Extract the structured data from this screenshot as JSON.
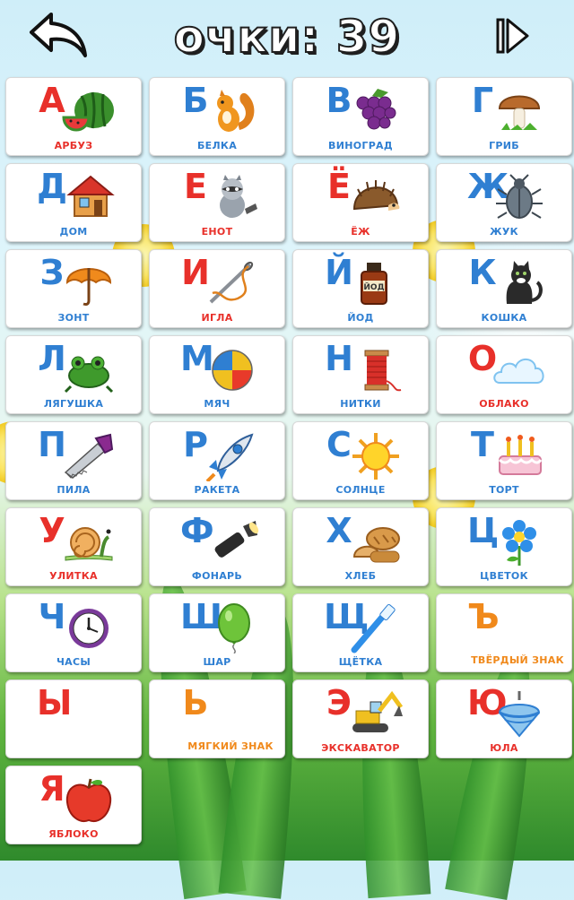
{
  "header": {
    "score_text": "очки: 39",
    "back_icon": "back-arrow-icon",
    "skip_icon": "skip-forward-icon"
  },
  "colors": {
    "vowel": "#e8302a",
    "consonant": "#2f7fd2",
    "sign": "#f0891b"
  },
  "cards": [
    {
      "letter": "А",
      "word": "АРБУЗ",
      "letter_color": "red",
      "word_color": "red",
      "icon": "watermelon"
    },
    {
      "letter": "Б",
      "word": "БЕЛКА",
      "letter_color": "blue",
      "word_color": "blue",
      "icon": "squirrel"
    },
    {
      "letter": "В",
      "word": "ВИНОГРАД",
      "letter_color": "blue",
      "word_color": "blue",
      "icon": "grapes"
    },
    {
      "letter": "Г",
      "word": "ГРИБ",
      "letter_color": "blue",
      "word_color": "blue",
      "icon": "mushroom"
    },
    {
      "letter": "Д",
      "word": "ДОМ",
      "letter_color": "blue",
      "word_color": "blue",
      "icon": "house"
    },
    {
      "letter": "Е",
      "word": "ЕНОТ",
      "letter_color": "red",
      "word_color": "red",
      "icon": "raccoon"
    },
    {
      "letter": "Ё",
      "word": "ЁЖ",
      "letter_color": "red",
      "word_color": "red",
      "icon": "hedgehog"
    },
    {
      "letter": "Ж",
      "word": "ЖУК",
      "letter_color": "blue",
      "word_color": "blue",
      "icon": "beetle"
    },
    {
      "letter": "З",
      "word": "ЗОНТ",
      "letter_color": "blue",
      "word_color": "blue",
      "icon": "umbrella"
    },
    {
      "letter": "И",
      "word": "ИГЛА",
      "letter_color": "red",
      "word_color": "red",
      "icon": "needle"
    },
    {
      "letter": "Й",
      "word": "ЙОД",
      "letter_color": "blue",
      "word_color": "blue",
      "icon": "iodine-bottle"
    },
    {
      "letter": "К",
      "word": "КОШКА",
      "letter_color": "blue",
      "word_color": "blue",
      "icon": "cat"
    },
    {
      "letter": "Л",
      "word": "ЛЯГУШКА",
      "letter_color": "blue",
      "word_color": "blue",
      "icon": "frog"
    },
    {
      "letter": "М",
      "word": "МЯЧ",
      "letter_color": "blue",
      "word_color": "blue",
      "icon": "ball"
    },
    {
      "letter": "Н",
      "word": "НИТКИ",
      "letter_color": "blue",
      "word_color": "blue",
      "icon": "thread-spool"
    },
    {
      "letter": "О",
      "word": "ОБЛАКО",
      "letter_color": "red",
      "word_color": "red",
      "icon": "cloud"
    },
    {
      "letter": "П",
      "word": "ПИЛА",
      "letter_color": "blue",
      "word_color": "blue",
      "icon": "saw"
    },
    {
      "letter": "Р",
      "word": "РАКЕТА",
      "letter_color": "blue",
      "word_color": "blue",
      "icon": "rocket"
    },
    {
      "letter": "С",
      "word": "СОЛНЦЕ",
      "letter_color": "blue",
      "word_color": "blue",
      "icon": "sun"
    },
    {
      "letter": "Т",
      "word": "ТОРТ",
      "letter_color": "blue",
      "word_color": "blue",
      "icon": "cake"
    },
    {
      "letter": "У",
      "word": "УЛИТКА",
      "letter_color": "red",
      "word_color": "red",
      "icon": "snail"
    },
    {
      "letter": "Ф",
      "word": "ФОНАРЬ",
      "letter_color": "blue",
      "word_color": "blue",
      "icon": "flashlight"
    },
    {
      "letter": "Х",
      "word": "ХЛЕБ",
      "letter_color": "blue",
      "word_color": "blue",
      "icon": "bread"
    },
    {
      "letter": "Ц",
      "word": "ЦВЕТОК",
      "letter_color": "blue",
      "word_color": "blue",
      "icon": "flower"
    },
    {
      "letter": "Ч",
      "word": "ЧАСЫ",
      "letter_color": "blue",
      "word_color": "blue",
      "icon": "clock"
    },
    {
      "letter": "Ш",
      "word": "ШАР",
      "letter_color": "blue",
      "word_color": "blue",
      "icon": "balloon"
    },
    {
      "letter": "Щ",
      "word": "ЩЁТКА",
      "letter_color": "blue",
      "word_color": "blue",
      "icon": "toothbrush"
    },
    {
      "letter": "Ъ",
      "word": "ТВЁРДЫЙ ЗНАК",
      "letter_color": "orange",
      "word_color": "orange",
      "icon": ""
    },
    {
      "letter": "Ы",
      "word": "",
      "letter_color": "red",
      "word_color": "red",
      "icon": ""
    },
    {
      "letter": "Ь",
      "word": "МЯГКИЙ ЗНАК",
      "letter_color": "orange",
      "word_color": "orange",
      "icon": ""
    },
    {
      "letter": "Э",
      "word": "ЭКСКАВАТОР",
      "letter_color": "red",
      "word_color": "red",
      "icon": "excavator"
    },
    {
      "letter": "Ю",
      "word": "ЮЛА",
      "letter_color": "red",
      "word_color": "red",
      "icon": "spinning-top"
    },
    {
      "letter": "Я",
      "word": "ЯБЛОКО",
      "letter_color": "red",
      "word_color": "red",
      "icon": "apple"
    }
  ]
}
